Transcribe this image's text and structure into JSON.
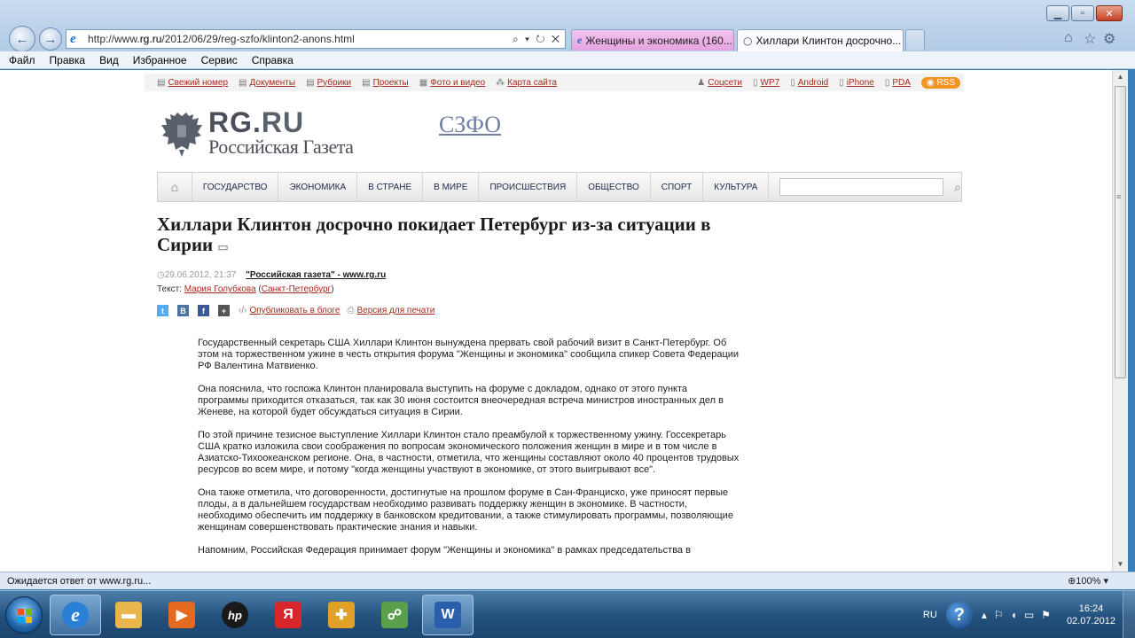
{
  "browser": {
    "url_prefix": "http://www.",
    "url_domain": "rg.ru",
    "url_path": "/2012/06/29/reg-szfo/klinton2-anons.html",
    "addr_tools": "⌕ ▾ ↻ ✕",
    "tabs": [
      {
        "label": "Женщины и экономика (160...",
        "active": false
      },
      {
        "label": "Хиллари Клинтон досрочно...",
        "active": true
      }
    ],
    "menu": [
      "Файл",
      "Правка",
      "Вид",
      "Избранное",
      "Сервис",
      "Справка"
    ],
    "status_text": "Ожидается ответ от www.rg.ru...",
    "zoom": "100%"
  },
  "site": {
    "topbar_left": [
      {
        "icon": "newspaper-icon",
        "label": "Свежий номер"
      },
      {
        "icon": "document-icon",
        "label": "Документы"
      },
      {
        "icon": "rubrics-icon",
        "label": "Рубрики"
      },
      {
        "icon": "projects-icon",
        "label": "Проекты"
      },
      {
        "icon": "photo-icon",
        "label": "Фото и видео"
      },
      {
        "icon": "sitemap-icon",
        "label": "Карта сайта"
      }
    ],
    "topbar_right": [
      {
        "icon": "people-icon",
        "label": "Соцсети"
      },
      {
        "icon": "phone-icon",
        "label": "WP7"
      },
      {
        "icon": "phone-icon",
        "label": "Android"
      },
      {
        "icon": "phone-icon",
        "label": "iPhone"
      },
      {
        "icon": "pda-icon",
        "label": "PDA"
      }
    ],
    "rss_label": "RSS",
    "logo_rg": "RG.",
    "logo_ru": "RU",
    "logo_gazeta": "Российская Газета",
    "region": "СЗФО",
    "nav": [
      "ГОСУДАРСТВО",
      "ЭКОНОМИКА",
      "В СТРАНЕ",
      "В МИРЕ",
      "ПРОИСШЕСТВИЯ",
      "ОБЩЕСТВО",
      "СПОРТ",
      "КУЛЬТУРА"
    ],
    "search_placeholder": ""
  },
  "article": {
    "title": "Хиллари Клинтон досрочно покидает Петербург из-за ситуации в Сирии",
    "date": "29.06.2012, 21:37",
    "source": "\"Российская газета\" - www.rg.ru",
    "author_prefix": "Текст: ",
    "author": "Мария Голубкова",
    "author_city": "Санкт-Петербург",
    "blog_link": "Опубликовать в блоге",
    "print_link": "Версия для печати",
    "paragraphs": [
      "Государственный секретарь США Хиллари Клинтон вынуждена прервать свой рабочий визит в Санкт-Петербург. Об этом на торжественном ужине в честь открытия форума \"Женщины и экономика\" сообщила спикер Совета Федерации РФ Валентина Матвиенко.",
      "Она пояснила, что госпожа Клинтон планировала выступить на форуме с докладом, однако от этого пункта программы приходится отказаться, так как 30 июня состоится внеочередная встреча министров иностранных дел в Женеве, на которой будет обсуждаться ситуация в Сирии.",
      "По этой причине тезисное выступление Хиллари Клинтон стало преамбулой к торжественному ужину. Госсекретарь США кратко изложила свои соображения по вопросам экономического положения женщин в мире и в том числе в Азиатско-Тихоокеанском регионе. Она, в частности, отметила, что женщины составляют около 40 процентов трудовых ресурсов во всем мире, и потому \"когда женщины участвуют в экономике, от этого выигрывают все\".",
      "Она также отметила, что договоренности, достигнутые на прошлом форуме в Сан-Франциско, уже приносят первые плоды, а в дальнейшем государствам необходимо развивать поддержку женщин в экономике. В частности, необходимо обеспечить им поддержку в банковском кредитовании, а также стимулировать программы, позволяющие женщинам совершенствовать практические знания и навыки.",
      "Напомним, Российская Федерация принимает форум \"Женщины и экономика\" в рамках председательства в"
    ]
  },
  "taskbar": {
    "items": [
      {
        "icon": "internet-explorer-icon",
        "color": "#2a7fd6"
      },
      {
        "icon": "folder-icon",
        "color": "#e8b64a"
      },
      {
        "icon": "media-player-icon",
        "color": "#e36a1e"
      },
      {
        "icon": "hp-icon",
        "color": "#1a1a1a"
      },
      {
        "icon": "yandex-icon",
        "color": "#d8262b"
      },
      {
        "icon": "puzzle-icon",
        "color": "#e0a126"
      },
      {
        "icon": "network-icon",
        "color": "#5aa04a"
      },
      {
        "icon": "word-icon",
        "color": "#2b5fae"
      }
    ],
    "lang": "RU",
    "time": "16:24",
    "date": "02.07.2012"
  }
}
